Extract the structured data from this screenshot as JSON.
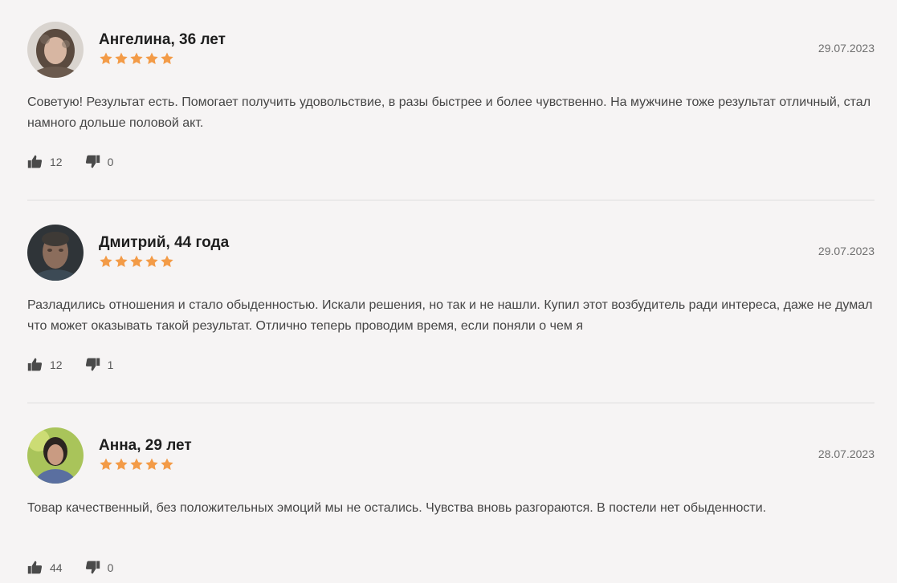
{
  "colors": {
    "background": "#f6f4f4",
    "star": "#f39b47",
    "divider": "#dddddd",
    "text": "#454545",
    "date": "#6f6f6f"
  },
  "reviews": [
    {
      "author": "Ангелина, 36 лет",
      "rating": 5,
      "date": "29.07.2023",
      "text": "Советую! Результат есть. Помогает получить удовольствие, в разы быстрее и более чувственно. На мужчине тоже результат отличный, стал намного дольше половой акт.",
      "likes": "12",
      "dislikes": "0",
      "avatar_icon": "user-photo-avatar"
    },
    {
      "author": "Дмитрий, 44 года",
      "rating": 5,
      "date": "29.07.2023",
      "text": "Разладились отношения и стало обыденностью. Искали решения, но так и не нашли. Купил этот возбудитель ради интереса, даже не думал что может оказывать такой результат. Отлично теперь проводим время, если поняли о чем я",
      "likes": "12",
      "dislikes": "1",
      "avatar_icon": "user-photo-avatar"
    },
    {
      "author": "Анна, 29 лет",
      "rating": 5,
      "date": "28.07.2023",
      "text": "Товар качественный, без положительных эмоций мы не остались. Чувства вновь разгораются. В постели нет обыденности.",
      "likes": "44",
      "dislikes": "0",
      "avatar_icon": "user-photo-avatar"
    }
  ],
  "icons": {
    "like": "thumbs-up-icon",
    "dislike": "thumbs-down-icon",
    "star": "star-icon"
  }
}
